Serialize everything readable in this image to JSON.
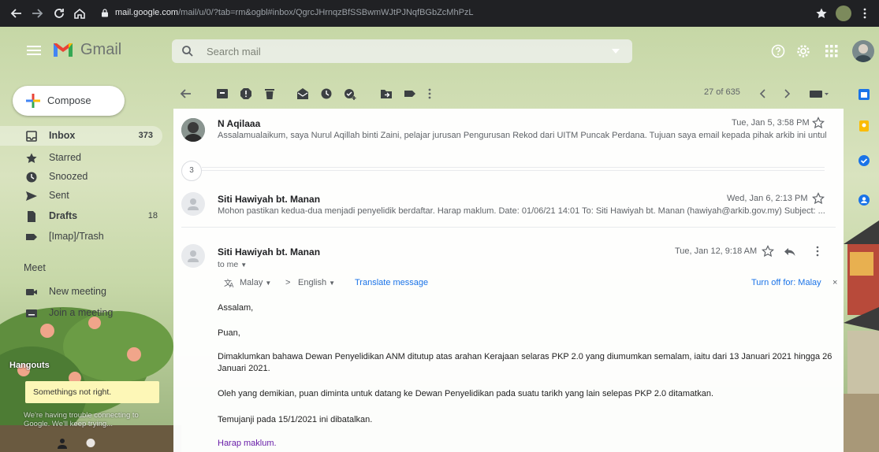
{
  "browser": {
    "url_host": "mail.google.com",
    "url_path": "/mail/u/0/?tab=rm&ogbl#inbox/QgrcJHrnqzBfSSBwmWJtPJNqfBGbZcMhPzL"
  },
  "header": {
    "app_name": "Gmail",
    "search_placeholder": "Search mail"
  },
  "compose_label": "Compose",
  "nav": [
    {
      "label": "Inbox",
      "count": "373",
      "icon": "inbox-icon"
    },
    {
      "label": "Starred",
      "count": "",
      "icon": "star-icon"
    },
    {
      "label": "Snoozed",
      "count": "",
      "icon": "clock-icon"
    },
    {
      "label": "Sent",
      "count": "",
      "icon": "send-icon"
    },
    {
      "label": "Drafts",
      "count": "18",
      "icon": "file-icon"
    },
    {
      "label": "[Imap]/Trash",
      "count": "",
      "icon": "label-icon"
    }
  ],
  "meet": {
    "title": "Meet",
    "new_meeting": "New meeting",
    "join_meeting": "Join a meeting"
  },
  "hangouts": {
    "title": "Hangouts",
    "warning": "Somethings not right.",
    "message": "We're having trouble connecting to Google. We'll keep trying..."
  },
  "toolbar": {
    "pager": "27 of 635"
  },
  "thread": {
    "collapsed_count": "3",
    "messages": [
      {
        "sender": "N Aqilaaa",
        "date": "Tue, Jan 5, 3:58 PM",
        "snippet": "Assalamualaikum, saya Nurul Aqillah binti Zaini, pelajar jurusan Pengurusan Rekod dari UITM Puncak Perdana. Tujuan saya email kepada pihak arkib ini untuk"
      },
      {
        "sender": "Siti Hawiyah bt. Manan",
        "date": "Wed, Jan 6, 2:13 PM",
        "snippet": "Mohon pastikan kedua-dua menjadi penyelidik berdaftar. Harap maklum. Date: 01/06/21 14:01 To: Siti Hawiyah bt. Manan (hawiyah@arkib.gov.my) Subject: ..."
      }
    ],
    "open_message": {
      "sender": "Siti Hawiyah bt. Manan",
      "date": "Tue, Jan 12, 9:18 AM",
      "to": "to me",
      "translate": {
        "from": "Malay",
        "arrow": ">",
        "to": "English",
        "action": "Translate message",
        "turn_off": "Turn off for: Malay"
      },
      "body": [
        "Assalam,",
        "Puan,",
        "Dimaklumkan bahawa Dewan Penyelidikan ANM ditutup atas arahan Kerajaan selaras PKP 2.0 yang diumumkan semalam, iaitu dari 13 Januari 2021 hingga 26 Januari 2021.",
        "Oleh yang demikian, puan diminta untuk datang ke Dewan Penyelidikan pada suatu tarikh yang lain selepas PKP 2.0 ditamatkan.",
        "Temujanji pada 15/1/2021 ini dibatalkan.",
        "Harap maklum."
      ]
    }
  },
  "colors": {
    "chrome": "#202124",
    "accent_blue": "#1a73e8",
    "link_purple": "#681da8"
  }
}
